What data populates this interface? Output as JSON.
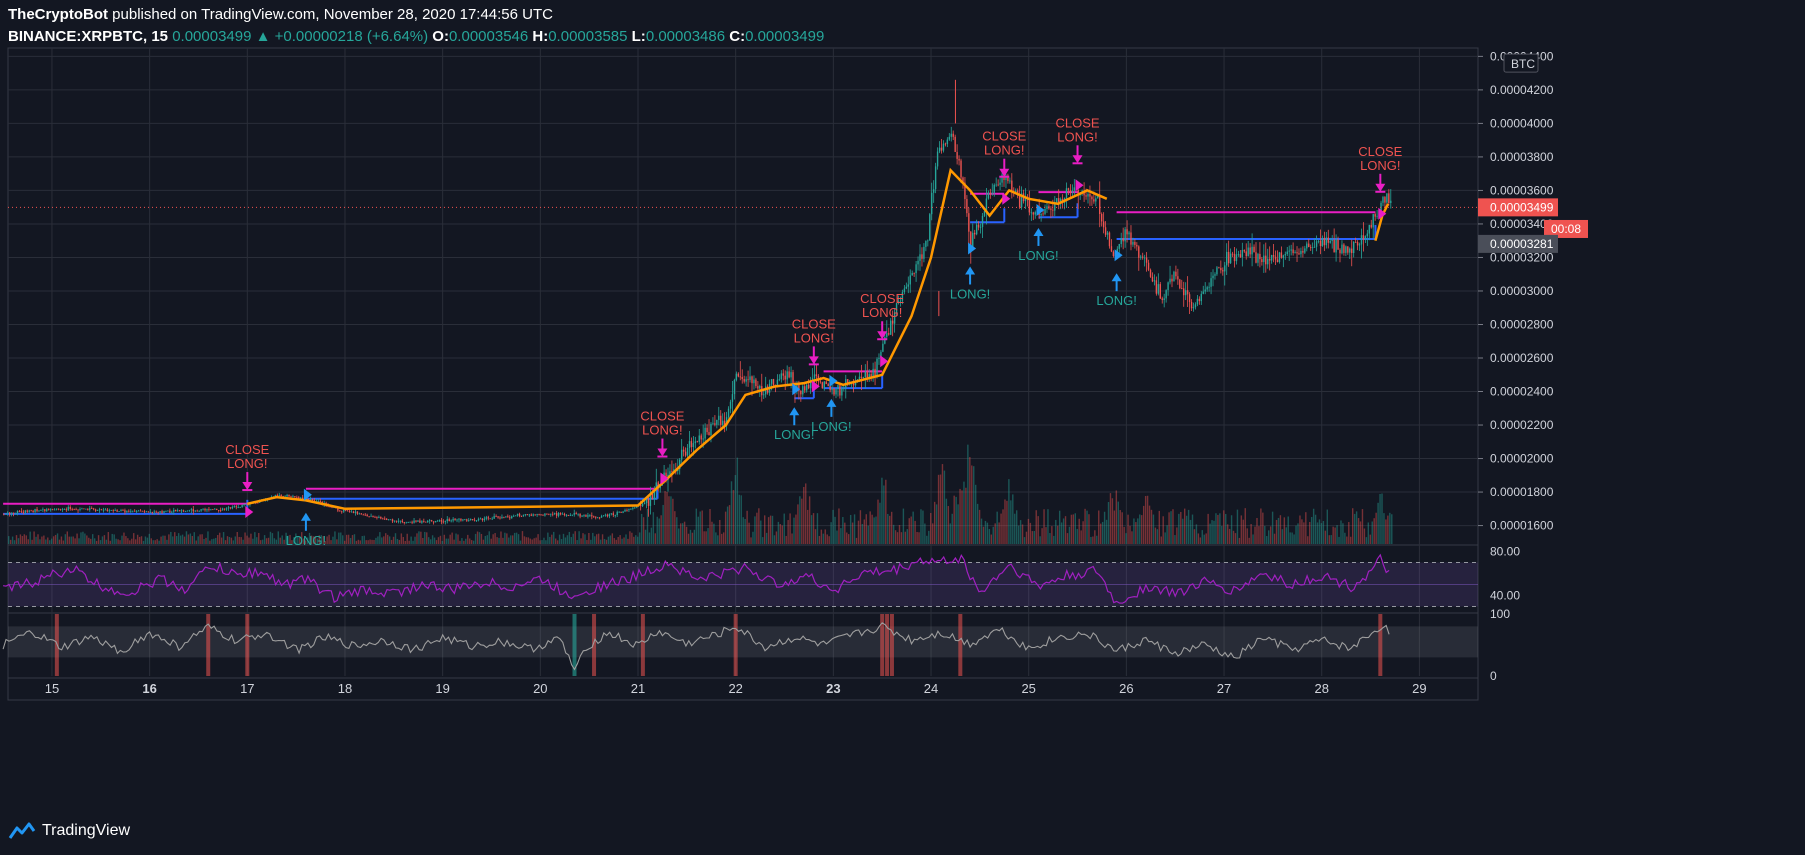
{
  "header": {
    "publisher": "TheCryptoBot",
    "published_text": " published on TradingView.com, November 28, 2020 17:44:56 UTC",
    "symbol": "BINANCE:XRPBTC, 15",
    "last": "0.00003499",
    "change": "+0.00000218 (+6.64%)",
    "o_label": "O:",
    "o": "0.00003546",
    "h_label": "H:",
    "h": "0.00003585",
    "l_label": "L:",
    "l": "0.00003486",
    "c_label": "C:",
    "c": "0.00003499"
  },
  "footer": {
    "brand": "TradingView"
  },
  "colors": {
    "background": "#131722",
    "grid": "#2a2e39",
    "up": "#26a69a",
    "down": "#ef5350",
    "ma": "#ff9800",
    "signal": "#e91ec4",
    "long_line": "#2962ff",
    "rsi": "#a020c0",
    "osc": "#9e9e9e",
    "label_close": "#ef5350",
    "label_long": "#26a69a",
    "arrow_long": "#2196f3"
  },
  "chart_data": {
    "type": "line",
    "price_axis": {
      "unit_label": "BTC",
      "ticks": [
        "0.00004400",
        "0.00004200",
        "0.00004000",
        "0.00003800",
        "0.00003600",
        "0.00003400",
        "0.00003200",
        "0.00003000",
        "0.00002800",
        "0.00002600",
        "0.00002400",
        "0.00002200",
        "0.00002000",
        "0.00001800",
        "0.00001600"
      ],
      "ylim": [
        1.49e-05,
        4.45e-05
      ],
      "last_price_label": "0.00003499",
      "countdown_label": "00:08",
      "marker_label": "0.00003281",
      "marker_value": 3.281e-05,
      "countdown_value": 3.37e-05
    },
    "time_axis": {
      "ticks": [
        "15",
        "16",
        "17",
        "18",
        "19",
        "20",
        "21",
        "22",
        "23",
        "24",
        "25",
        "26",
        "27",
        "28",
        "29"
      ]
    },
    "price_series": {
      "name": "",
      "x": [
        14.5,
        14.8,
        15.2,
        15.6,
        16.0,
        16.4,
        16.8,
        17.0,
        17.3,
        17.6,
        17.9,
        18.2,
        18.6,
        19.0,
        19.4,
        19.8,
        20.2,
        20.6,
        20.9,
        21.1,
        21.3,
        21.5,
        21.7,
        21.9,
        22.0,
        22.1,
        22.3,
        22.5,
        22.7,
        22.8,
        22.9,
        23.0,
        23.2,
        23.4,
        23.6,
        23.8,
        23.95,
        24.05,
        24.2,
        24.3,
        24.4,
        24.5,
        24.6,
        24.75,
        24.9,
        25.1,
        25.3,
        25.5,
        25.7,
        25.85,
        26.0,
        26.2,
        26.35,
        26.5,
        26.65,
        26.8,
        27.0,
        27.2,
        27.4,
        27.6,
        27.8,
        28.0,
        28.2,
        28.4,
        28.55,
        28.65,
        28.7
      ],
      "y": [
        1.67e-05,
        1.69e-05,
        1.7e-05,
        1.69e-05,
        1.68e-05,
        1.69e-05,
        1.7e-05,
        1.73e-05,
        1.78e-05,
        1.76e-05,
        1.7e-05,
        1.66e-05,
        1.62e-05,
        1.63e-05,
        1.64e-05,
        1.66e-05,
        1.67e-05,
        1.65e-05,
        1.69e-05,
        1.76e-05,
        1.9e-05,
        2.05e-05,
        2.18e-05,
        2.25e-05,
        2.5e-05,
        2.45e-05,
        2.4e-05,
        2.5e-05,
        2.4e-05,
        2.52e-05,
        2.44e-05,
        2.4e-05,
        2.45e-05,
        2.5e-05,
        2.85e-05,
        3.1e-05,
        3.3e-05,
        3.8e-05,
        3.95e-05,
        3.7e-05,
        3.3e-05,
        3.4e-05,
        3.6e-05,
        3.7e-05,
        3.55e-05,
        3.45e-05,
        3.55e-05,
        3.62e-05,
        3.55e-05,
        3.2e-05,
        3.35e-05,
        3.15e-05,
        2.95e-05,
        3.1e-05,
        2.9e-05,
        3e-05,
        3.18e-05,
        3.25e-05,
        3.18e-05,
        3.22e-05,
        3.25e-05,
        3.3e-05,
        3.25e-05,
        3.3e-05,
        3.45e-05,
        3.58e-05,
        3.5e-05
      ]
    },
    "ma_series": {
      "name": "",
      "x": [
        17.0,
        17.3,
        17.6,
        18.0,
        21.0,
        21.3,
        21.6,
        21.9,
        22.1,
        22.4,
        22.7,
        22.9,
        23.1,
        23.5,
        23.8,
        24.0,
        24.2,
        24.4,
        24.6,
        24.8,
        25.0,
        25.3,
        25.6,
        25.8
      ],
      "y": [
        1.73e-05,
        1.77e-05,
        1.75e-05,
        1.7e-05,
        1.72e-05,
        1.88e-05,
        2.05e-05,
        2.2e-05,
        2.38e-05,
        2.43e-05,
        2.45e-05,
        2.48e-05,
        2.44e-05,
        2.5e-05,
        2.85e-05,
        3.2e-05,
        3.72e-05,
        3.6e-05,
        3.45e-05,
        3.6e-05,
        3.55e-05,
        3.52e-05,
        3.6e-05,
        3.55e-05
      ]
    },
    "position_lines": [
      {
        "kind": "long",
        "x": [
          14.5,
          17.0
        ],
        "y": 1.67e-05
      },
      {
        "kind": "close",
        "x": [
          14.5,
          17.0
        ],
        "y": 1.73e-05
      },
      {
        "kind": "long",
        "x": [
          17.6,
          21.2
        ],
        "y": 1.76e-05
      },
      {
        "kind": "close",
        "x": [
          17.6,
          21.2
        ],
        "y": 1.82e-05
      },
      {
        "kind": "long",
        "x": [
          22.6,
          22.8
        ],
        "y": 2.36e-05
      },
      {
        "kind": "long",
        "x": [
          22.9,
          23.5
        ],
        "y": 2.42e-05
      },
      {
        "kind": "close",
        "x": [
          22.9,
          23.5
        ],
        "y": 2.52e-05
      },
      {
        "kind": "long",
        "x": [
          24.4,
          24.75
        ],
        "y": 3.41e-05
      },
      {
        "kind": "close",
        "x": [
          24.4,
          24.75
        ],
        "y": 3.58e-05
      },
      {
        "kind": "long",
        "x": [
          25.1,
          25.5
        ],
        "y": 3.44e-05
      },
      {
        "kind": "close",
        "x": [
          25.1,
          25.5
        ],
        "y": 3.59e-05
      },
      {
        "kind": "long",
        "x": [
          25.9,
          28.55
        ],
        "y": 3.31e-05
      },
      {
        "kind": "close",
        "x": [
          25.9,
          28.55
        ],
        "y": 3.47e-05
      }
    ],
    "signals": [
      {
        "type": "close",
        "x": 17.0,
        "y": 1.8e-05,
        "line1": "CLOSE",
        "line2": "LONG!"
      },
      {
        "type": "long",
        "x": 17.6,
        "y": 1.7e-05,
        "line1": "LONG!"
      },
      {
        "type": "close",
        "x": 21.25,
        "y": 2e-05,
        "line1": "CLOSE",
        "line2": "LONG!"
      },
      {
        "type": "long",
        "x": 22.6,
        "y": 2.33e-05,
        "line1": "LONG!"
      },
      {
        "type": "close",
        "x": 22.8,
        "y": 2.55e-05,
        "line1": "CLOSE",
        "line2": "LONG!"
      },
      {
        "type": "long",
        "x": 22.98,
        "y": 2.38e-05,
        "line1": "LONG!"
      },
      {
        "type": "close",
        "x": 23.5,
        "y": 2.7e-05,
        "line1": "CLOSE",
        "line2": "LONG!"
      },
      {
        "type": "long",
        "x": 24.4,
        "y": 3.17e-05,
        "line1": "LONG!"
      },
      {
        "type": "close",
        "x": 24.75,
        "y": 3.67e-05,
        "line1": "CLOSE",
        "line2": "LONG!"
      },
      {
        "type": "long",
        "x": 25.1,
        "y": 3.4e-05,
        "line1": "LONG!"
      },
      {
        "type": "close",
        "x": 25.5,
        "y": 3.75e-05,
        "line1": "CLOSE",
        "line2": "LONG!"
      },
      {
        "type": "long",
        "x": 25.9,
        "y": 3.13e-05,
        "line1": "LONG!"
      },
      {
        "type": "close",
        "x": 28.6,
        "y": 3.58e-05,
        "line1": "CLOSE",
        "line2": "LONG!"
      }
    ],
    "volume_spikes": [
      {
        "x": 21.3,
        "v": 0.55
      },
      {
        "x": 22.0,
        "v": 0.8
      },
      {
        "x": 22.7,
        "v": 0.6
      },
      {
        "x": 23.5,
        "v": 0.65
      },
      {
        "x": 24.1,
        "v": 0.8
      },
      {
        "x": 24.3,
        "v": 0.75
      },
      {
        "x": 24.4,
        "v": 1.0
      },
      {
        "x": 24.8,
        "v": 0.65
      },
      {
        "x": 25.85,
        "v": 0.6
      },
      {
        "x": 26.2,
        "v": 0.45
      },
      {
        "x": 26.6,
        "v": 0.45
      },
      {
        "x": 28.6,
        "v": 0.5
      }
    ],
    "rsi": {
      "ticks": [
        "80.00",
        "40.00"
      ],
      "upper": 70,
      "lower": 30,
      "ylim": [
        25,
        85
      ],
      "x": [
        14.5,
        14.9,
        15.2,
        15.5,
        15.8,
        16.1,
        16.4,
        16.6,
        16.9,
        17.1,
        17.4,
        17.6,
        17.9,
        18.2,
        18.5,
        18.8,
        19.1,
        19.4,
        19.7,
        20.0,
        20.3,
        20.6,
        20.9,
        21.1,
        21.3,
        21.6,
        21.9,
        22.1,
        22.4,
        22.7,
        23.0,
        23.3,
        23.6,
        23.9,
        24.1,
        24.3,
        24.5,
        24.8,
        25.1,
        25.4,
        25.7,
        25.9,
        26.2,
        26.5,
        26.8,
        27.1,
        27.4,
        27.7,
        28.0,
        28.3,
        28.5,
        28.6,
        28.7
      ],
      "y": [
        45,
        55,
        65,
        48,
        42,
        55,
        45,
        68,
        58,
        62,
        50,
        55,
        38,
        45,
        42,
        50,
        45,
        52,
        48,
        55,
        40,
        48,
        55,
        62,
        70,
        55,
        60,
        66,
        50,
        58,
        45,
        60,
        62,
        72,
        70,
        75,
        42,
        68,
        48,
        58,
        62,
        32,
        48,
        42,
        52,
        44,
        60,
        50,
        58,
        48,
        60,
        72,
        58
      ]
    },
    "oscillator": {
      "ticks": [
        "100",
        "0"
      ],
      "ylim": [
        0,
        100
      ],
      "x": [
        14.5,
        14.8,
        15.1,
        15.4,
        15.7,
        16.0,
        16.3,
        16.6,
        16.9,
        17.2,
        17.5,
        17.8,
        18.1,
        18.4,
        18.7,
        19.0,
        19.3,
        19.6,
        19.9,
        20.2,
        20.35,
        20.5,
        20.7,
        21.0,
        21.2,
        21.5,
        21.8,
        22.0,
        22.3,
        22.6,
        22.9,
        23.2,
        23.5,
        23.8,
        24.1,
        24.4,
        24.7,
        25.0,
        25.3,
        25.6,
        25.9,
        26.2,
        26.5,
        26.8,
        27.1,
        27.4,
        27.7,
        28.0,
        28.3,
        28.6,
        28.7
      ],
      "y": [
        50,
        70,
        45,
        62,
        40,
        68,
        48,
        78,
        55,
        70,
        42,
        62,
        48,
        58,
        42,
        62,
        48,
        56,
        44,
        60,
        10,
        50,
        70,
        48,
        72,
        52,
        66,
        80,
        46,
        62,
        50,
        66,
        80,
        58,
        70,
        52,
        76,
        44,
        62,
        68,
        40,
        58,
        36,
        50,
        28,
        62,
        42,
        58,
        44,
        80,
        72
      ]
    },
    "osc_highlights": [
      {
        "x": 15.05,
        "color": "red"
      },
      {
        "x": 16.6,
        "color": "red"
      },
      {
        "x": 17.0,
        "color": "red"
      },
      {
        "x": 20.35,
        "color": "green"
      },
      {
        "x": 20.55,
        "color": "red"
      },
      {
        "x": 21.05,
        "color": "red"
      },
      {
        "x": 22.0,
        "color": "red"
      },
      {
        "x": 23.5,
        "color": "red"
      },
      {
        "x": 23.55,
        "color": "red"
      },
      {
        "x": 23.6,
        "color": "red"
      },
      {
        "x": 24.3,
        "color": "red"
      },
      {
        "x": 28.6,
        "color": "red"
      }
    ],
    "xlim": [
      14.55,
      29.6
    ]
  }
}
